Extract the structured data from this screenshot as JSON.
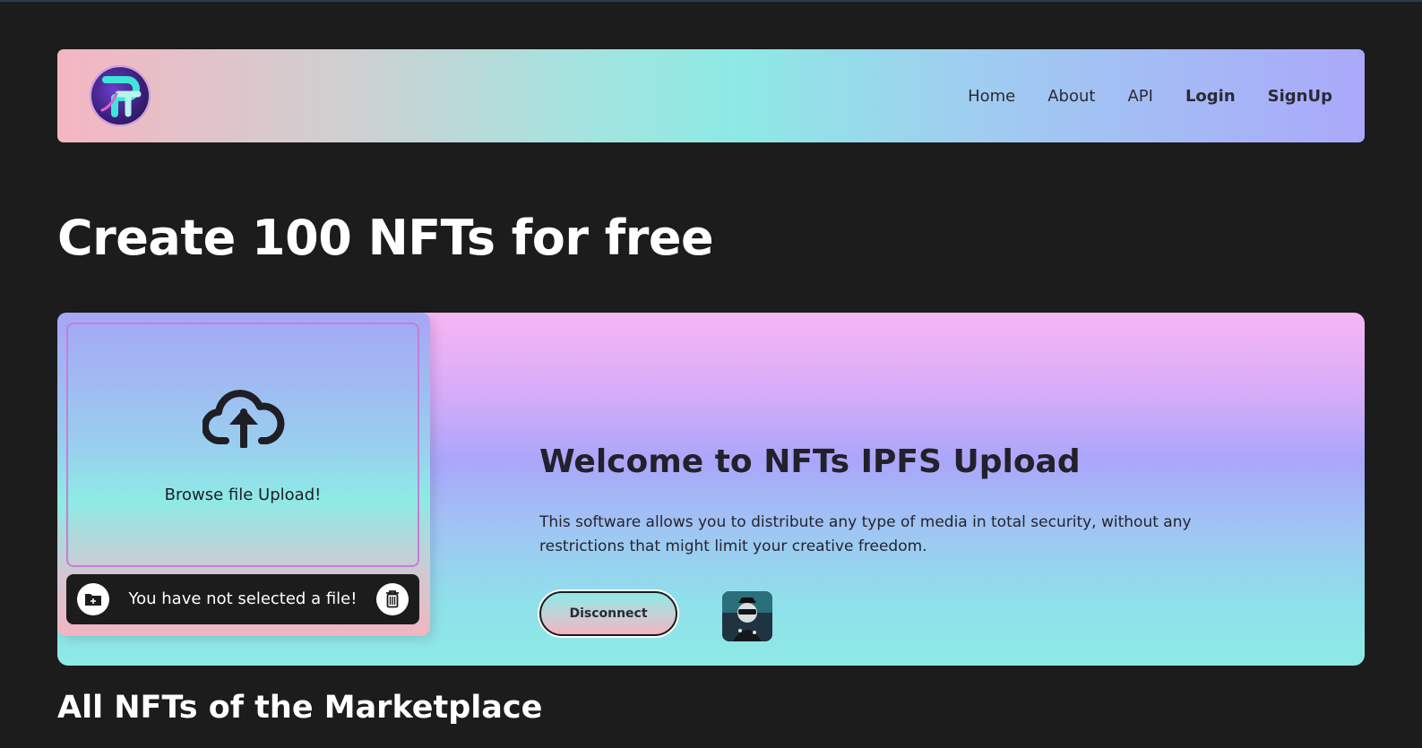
{
  "nav": {
    "links": [
      {
        "label": "Home"
      },
      {
        "label": "About"
      },
      {
        "label": "API"
      },
      {
        "label": "Login"
      },
      {
        "label": "SignUp"
      }
    ]
  },
  "page_title": "Create 100 NFTs for free",
  "upload": {
    "drop_text": "Browse file Upload!",
    "file_status": "You have not selected a file!",
    "icons": [
      "cloud-upload-icon",
      "folder-add-icon",
      "trash-icon"
    ]
  },
  "hero": {
    "title": "Welcome to NFTs IPFS Upload",
    "description": "This software allows you to distribute any type of media in total security, without any restrictions that might limit your creative freedom.",
    "disconnect_label": "Disconnect"
  },
  "section_title": "All NFTs of the Marketplace",
  "colors": {
    "background": "#1c1c1d",
    "accent_pink": "#f7b6f3",
    "accent_purple": "#aaa6fa",
    "accent_cyan": "#8eeae5",
    "text_dark": "#22202a"
  }
}
